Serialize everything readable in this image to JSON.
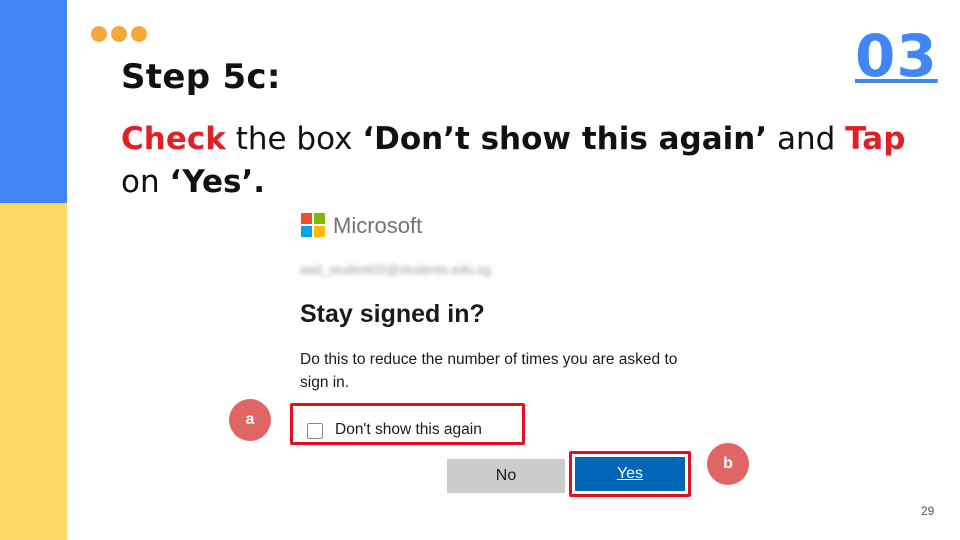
{
  "slide": {
    "title": "Step 5c:",
    "number": "03",
    "page": "29",
    "instruction": {
      "check_word": "Check",
      "mid_text": " the box ",
      "box_name": "‘Don’t show this again’",
      "and_text": " and ",
      "tap_word": "Tap",
      "on_text": "on ",
      "yes_name": "‘Yes’."
    }
  },
  "dialog": {
    "brand": "Microsoft",
    "email_obscured": "aad_student02@students.edu.sg",
    "heading": "Stay signed in?",
    "description": "Do this to reduce the number of times you are asked to sign in.",
    "checkbox_label": "Don't show this again",
    "no_button": "No",
    "yes_button": "Yes"
  },
  "callouts": {
    "a": "a",
    "b": "b"
  },
  "colors": {
    "accent_blue": "#4285f4",
    "accent_yellow": "#ffd966",
    "dots_orange": "#f6a93b",
    "highlight_red": "#e31f26",
    "callout_red": "#e06666",
    "ms_button_blue": "#0067b8"
  },
  "icons": [
    "microsoft-logo-icon",
    "decorative-dots-icon",
    "checkbox-icon"
  ]
}
